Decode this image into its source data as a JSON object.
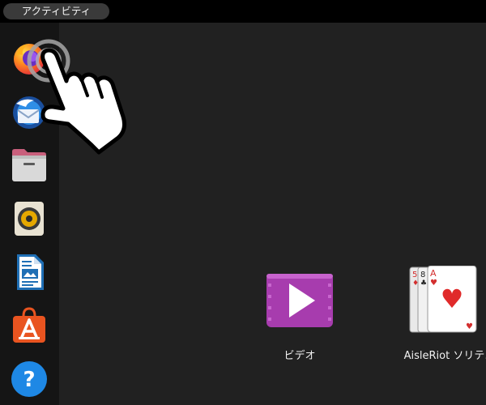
{
  "topbar": {
    "activities_label": "アクティビティ"
  },
  "dock": {
    "items": [
      {
        "name": "Firefox",
        "icon": "firefox-icon"
      },
      {
        "name": "Thunderbird",
        "icon": "thunderbird-icon"
      },
      {
        "name": "Files",
        "icon": "files-icon"
      },
      {
        "name": "Rhythmbox",
        "icon": "speaker-icon"
      },
      {
        "name": "LibreOffice Writer",
        "icon": "writer-icon"
      },
      {
        "name": "Ubuntu Software",
        "icon": "software-bag-icon"
      },
      {
        "name": "Help",
        "icon": "help-icon"
      }
    ]
  },
  "apps": [
    {
      "label": "ビデオ",
      "icon": "video-play-icon"
    },
    {
      "label": "AisleRiot ソリテ…",
      "icon": "playing-cards-icon"
    }
  ],
  "pointer": {
    "icon": "hand-pointer-icon",
    "state": "click"
  },
  "colors": {
    "topbar": "#000000",
    "dock": "#151515",
    "background": "#212121",
    "video_icon": "#b04ab8",
    "software_icon": "#e95420",
    "help_icon": "#1e88e5"
  }
}
